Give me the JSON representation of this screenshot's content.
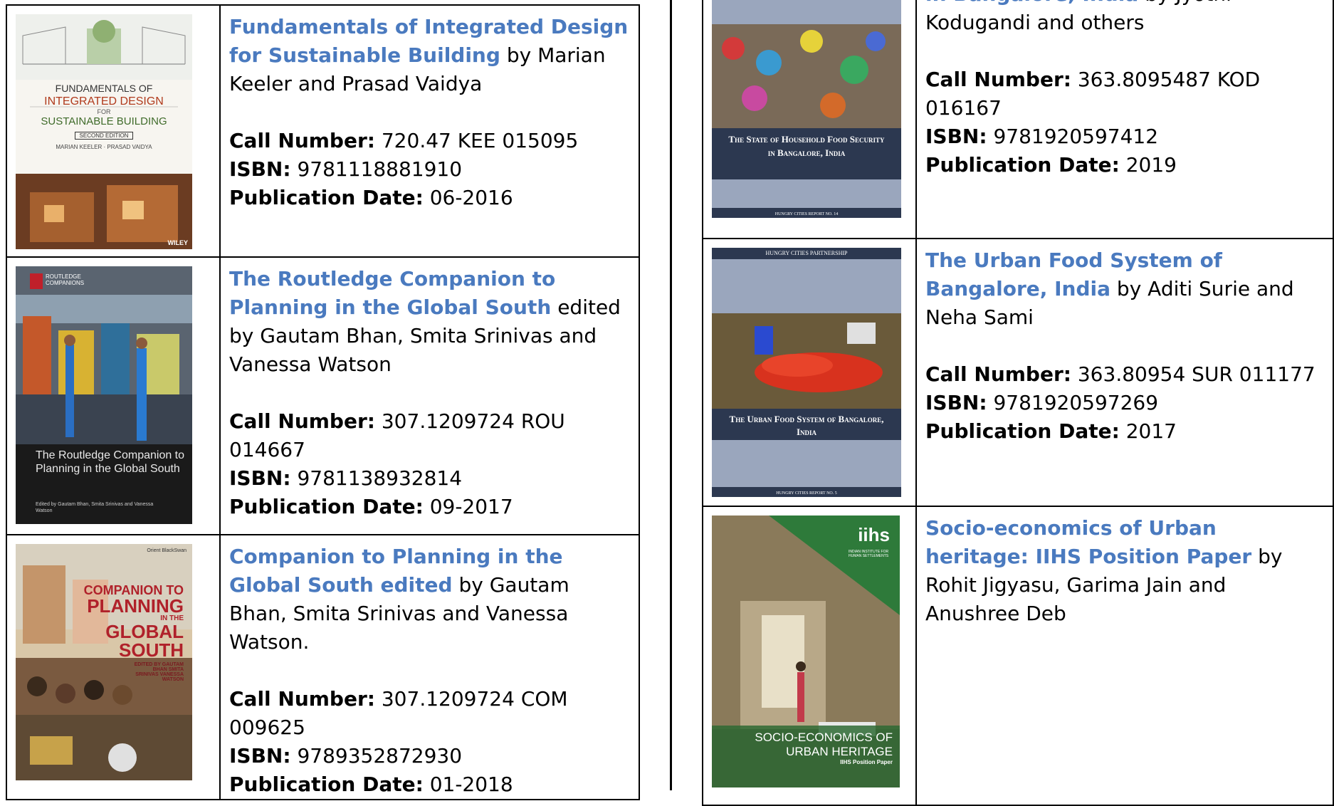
{
  "labels": {
    "call_number": "Call Number:",
    "isbn": "ISBN:",
    "pub_date": "Publication Date:"
  },
  "left_books": [
    {
      "title": "Fundamentals of Integrated Design for Sustainable Building",
      "byline": " by Marian Keeler and Prasad Vaidya",
      "call_number": " 720.47 KEE 015095",
      "isbn": " 9781118881910",
      "pub_date": " 06-2016",
      "cover": {
        "line1": "FUNDAMENTALS OF",
        "line2": "INTEGRATED DESIGN",
        "line3": "FOR",
        "line4": "SUSTAINABLE BUILDING",
        "authors": "MARIAN KEELER · PRASAD VAIDYA",
        "edition": "SECOND EDITION",
        "publisher": "WILEY"
      }
    },
    {
      "title": "The Routledge Companion to Planning in the Global South",
      "byline": " edited by Gautam Bhan, Smita Srinivas and Vanessa Watson",
      "call_number": " 307.1209724 ROU 014667",
      "isbn": " 9781138932814",
      "pub_date": " 09-2017",
      "cover": {
        "series": "ROUTLEDGE COMPANIONS",
        "title": "The Routledge Companion to Planning in the Global South",
        "editors": "Edited by Gautam Bhan, Smita Srinivas and Vanessa Watson"
      }
    },
    {
      "title": "Companion to Planning in the Global South edited",
      "byline": " by Gautam Bhan, Smita Srinivas and Vanessa Watson.",
      "call_number": " 307.1209724 COM 009625",
      "isbn": " 9789352872930",
      "pub_date": " 01-2018",
      "cover": {
        "publisher": "Orient BlackSwan",
        "line1": "COMPANION TO",
        "line2": "PLANNING",
        "line3": "IN THE",
        "line4": "GLOBAL",
        "line5": "SOUTH",
        "editors": "EDITED BY GAUTAM BHAN SMITA SRINIVAS VANESSA WATSON"
      }
    }
  ],
  "right_books": [
    {
      "title": "in Bangalore, India",
      "byline": " by Jyothi Kodugandi and others",
      "call_number": " 363.8095487 KOD 016167",
      "isbn": " 9781920597412",
      "pub_date": " 2019",
      "cover": {
        "title": "The State of Household Food Security in Bangalore, India",
        "footer": "HUNGRY CITIES REPORT NO. 14"
      }
    },
    {
      "title": "The Urban Food System of Bangalore, India",
      "byline": " by Aditi Surie and Neha Sami",
      "call_number": " 363.80954 SUR 011177",
      "isbn": " 9781920597269",
      "pub_date": " 2017",
      "cover": {
        "header": "HUNGRY CITIES PARTNERSHIP",
        "title": "The Urban Food System of Bangalore, India",
        "footer": "HUNGRY CITIES REPORT NO. 5"
      }
    },
    {
      "title": "Socio-economics of Urban heritage: IIHS Position Paper",
      "byline": " by Rohit Jigyasu, Garima Jain and Anushree Deb",
      "cover": {
        "logo": "iihs",
        "institute": "INDIAN INSTITUTE FOR HUMAN SETTLEMENTS",
        "line1": "SOCIO-ECONOMICS OF",
        "line2": "URBAN HERITAGE",
        "line3": "IIHS Position Paper"
      }
    }
  ]
}
